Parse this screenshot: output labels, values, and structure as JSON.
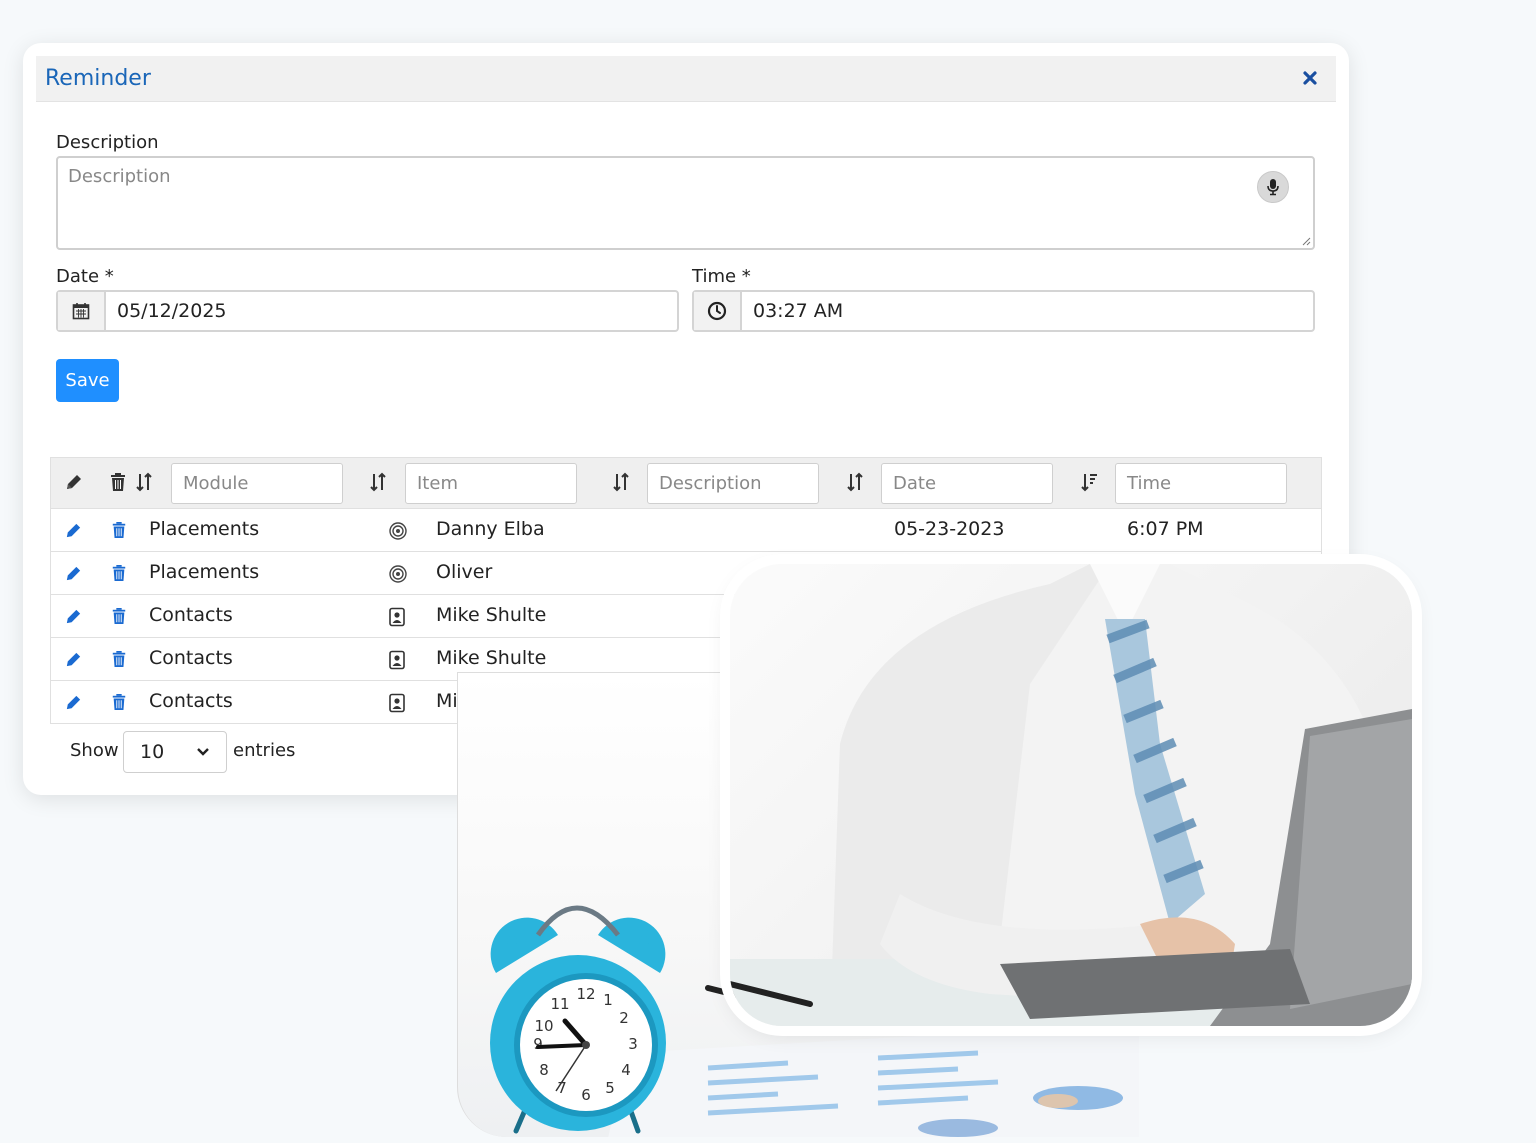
{
  "modal": {
    "title": "Reminder",
    "close_icon": "close-icon"
  },
  "form": {
    "description_label": "Description",
    "description_placeholder": "Description",
    "date_label": "Date *",
    "date_value": "05/12/2025",
    "time_label": "Time *",
    "time_value": "03:27 AM",
    "save_label": "Save"
  },
  "table": {
    "filters": {
      "module": "Module",
      "item": "Item",
      "description": "Description",
      "date": "Date",
      "time": "Time"
    },
    "rows": [
      {
        "module": "Placements",
        "item_icon": "target-icon",
        "item": "Danny Elba",
        "date": "05-23-2023",
        "time": "6:07 PM"
      },
      {
        "module": "Placements",
        "item_icon": "target-icon",
        "item": "Oliver",
        "date": "",
        "time": ""
      },
      {
        "module": "Contacts",
        "item_icon": "contact-card-icon",
        "item": "Mike Shulte",
        "date": "",
        "time": ""
      },
      {
        "module": "Contacts",
        "item_icon": "contact-card-icon",
        "item": "Mike Shulte",
        "date": "",
        "time": ""
      },
      {
        "module": "Contacts",
        "item_icon": "contact-card-icon",
        "item": "Mik",
        "date": "",
        "time": ""
      }
    ]
  },
  "pagination": {
    "show_label": "Show",
    "page_size": "10",
    "entries_label": "entries"
  },
  "colors": {
    "accent": "#1f8fff",
    "title_blue": "#1a66b8",
    "alarm_clock": "#2ab4dc"
  }
}
